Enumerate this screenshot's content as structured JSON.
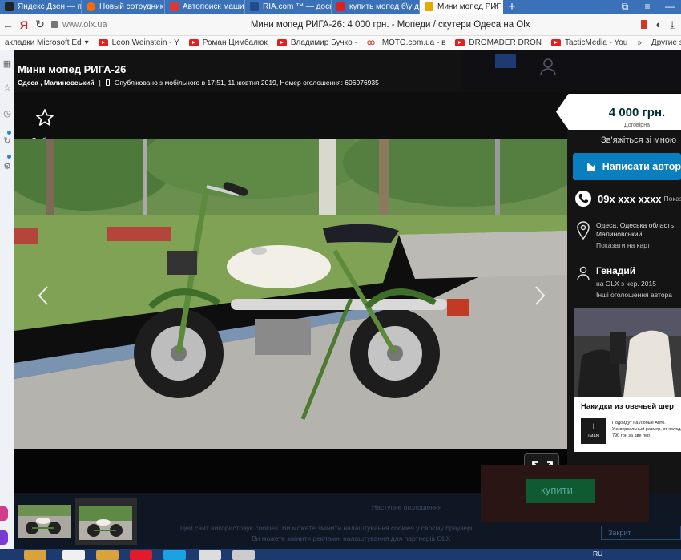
{
  "browser": {
    "tabs": [
      {
        "label": "Яндекс Дзен — пер",
        "favicon_color": "#222222"
      },
      {
        "label": "Новый сотрудник",
        "favicon_color": "#ff6a00"
      },
      {
        "label": "Автопоиск машин",
        "favicon_color": "#d83a3a"
      },
      {
        "label": "RIA.com ™ — доск",
        "favicon_color": "#1e4d8f"
      },
      {
        "label": "купить мопед б\\у д",
        "favicon_color": "#e02020"
      },
      {
        "label": "Мини мопед РИГ",
        "favicon_color": "#e8a900",
        "active": true
      }
    ],
    "new_tab": "+",
    "url": "www.olx.ua",
    "page_title": "Мини мопед РИГА-26: 4 000 грн. - Мопеди / скутери Одеса на Olx",
    "bookmarks": [
      "акладки Microsoft Ed",
      "Leon Weinstein - Y",
      "Роман Цимбалюк",
      "Владимир Бучко -",
      "MOTO.com.ua - в",
      "DROMADER DRON",
      "TacticMedia - You"
    ],
    "bookmarks_overflow": "»",
    "other_bookmarks": "Другие зак"
  },
  "ad": {
    "title": "Мини мопед РИГА-26",
    "location": "Одеса , Малиновський",
    "published": "Опубліковано з мобільного в 17:51, 11 жовтня 2019, Номер оголошення: 606976935",
    "favorite_label": "В обрані"
  },
  "contact": {
    "price": "4 000 грн.",
    "price_note": "Договірна",
    "contact_heading": "Зв'яжіться зі мною",
    "write_button": "Написати автор",
    "phone": "09x xxx xxxx",
    "phone_show": "Показат",
    "location": "Одеса, Одеська область, Малиновський",
    "show_on_map": "Показати на карті",
    "seller_name": "Генадий",
    "seller_since": "на OLX з чер. 2015",
    "other_ads": "Інші оголошення автора"
  },
  "promo": {
    "title": "Накидки из овечьей шер",
    "logo_text": "IMAN",
    "text": "Подойдут на Любые Авто. Универсальный размер, от холода. 790 грн за две пер"
  },
  "footer": {
    "cookie_line1": "Цей сайт використовує cookies. Ви можете змінити налаштування cookies у своєму браузері.",
    "cookie_line2": "Ви можете змінити рекламні налаштування для партнерів OLX",
    "faded_link": "Наступне оголошення",
    "faded_button": "Закрит",
    "faded_green": "купити"
  },
  "taskbar": {
    "lang": "RU"
  },
  "colors": {
    "olx_dark": "#002f34",
    "accent_blue": "#0a7fbf",
    "tab_strip": "#3a71b8"
  }
}
